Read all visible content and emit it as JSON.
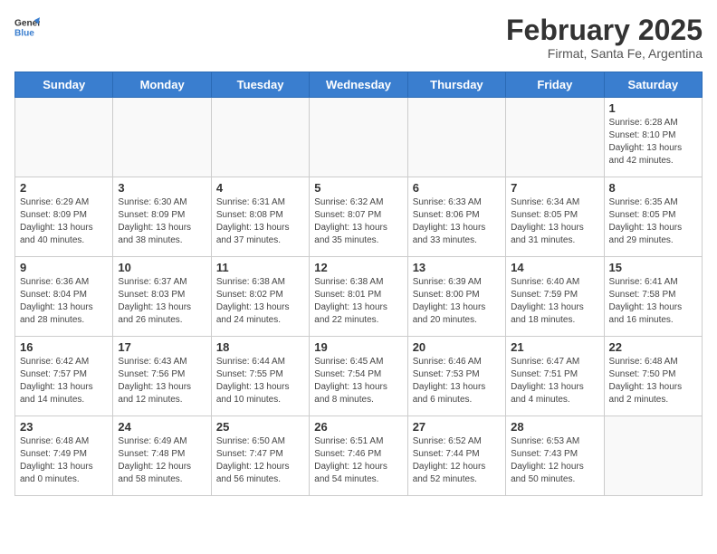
{
  "logo": {
    "general": "General",
    "blue": "Blue"
  },
  "header": {
    "title": "February 2025",
    "subtitle": "Firmat, Santa Fe, Argentina"
  },
  "days_of_week": [
    "Sunday",
    "Monday",
    "Tuesday",
    "Wednesday",
    "Thursday",
    "Friday",
    "Saturday"
  ],
  "weeks": [
    [
      {
        "day": "",
        "info": ""
      },
      {
        "day": "",
        "info": ""
      },
      {
        "day": "",
        "info": ""
      },
      {
        "day": "",
        "info": ""
      },
      {
        "day": "",
        "info": ""
      },
      {
        "day": "",
        "info": ""
      },
      {
        "day": "1",
        "info": "Sunrise: 6:28 AM\nSunset: 8:10 PM\nDaylight: 13 hours and 42 minutes."
      }
    ],
    [
      {
        "day": "2",
        "info": "Sunrise: 6:29 AM\nSunset: 8:09 PM\nDaylight: 13 hours and 40 minutes."
      },
      {
        "day": "3",
        "info": "Sunrise: 6:30 AM\nSunset: 8:09 PM\nDaylight: 13 hours and 38 minutes."
      },
      {
        "day": "4",
        "info": "Sunrise: 6:31 AM\nSunset: 8:08 PM\nDaylight: 13 hours and 37 minutes."
      },
      {
        "day": "5",
        "info": "Sunrise: 6:32 AM\nSunset: 8:07 PM\nDaylight: 13 hours and 35 minutes."
      },
      {
        "day": "6",
        "info": "Sunrise: 6:33 AM\nSunset: 8:06 PM\nDaylight: 13 hours and 33 minutes."
      },
      {
        "day": "7",
        "info": "Sunrise: 6:34 AM\nSunset: 8:05 PM\nDaylight: 13 hours and 31 minutes."
      },
      {
        "day": "8",
        "info": "Sunrise: 6:35 AM\nSunset: 8:05 PM\nDaylight: 13 hours and 29 minutes."
      }
    ],
    [
      {
        "day": "9",
        "info": "Sunrise: 6:36 AM\nSunset: 8:04 PM\nDaylight: 13 hours and 28 minutes."
      },
      {
        "day": "10",
        "info": "Sunrise: 6:37 AM\nSunset: 8:03 PM\nDaylight: 13 hours and 26 minutes."
      },
      {
        "day": "11",
        "info": "Sunrise: 6:38 AM\nSunset: 8:02 PM\nDaylight: 13 hours and 24 minutes."
      },
      {
        "day": "12",
        "info": "Sunrise: 6:38 AM\nSunset: 8:01 PM\nDaylight: 13 hours and 22 minutes."
      },
      {
        "day": "13",
        "info": "Sunrise: 6:39 AM\nSunset: 8:00 PM\nDaylight: 13 hours and 20 minutes."
      },
      {
        "day": "14",
        "info": "Sunrise: 6:40 AM\nSunset: 7:59 PM\nDaylight: 13 hours and 18 minutes."
      },
      {
        "day": "15",
        "info": "Sunrise: 6:41 AM\nSunset: 7:58 PM\nDaylight: 13 hours and 16 minutes."
      }
    ],
    [
      {
        "day": "16",
        "info": "Sunrise: 6:42 AM\nSunset: 7:57 PM\nDaylight: 13 hours and 14 minutes."
      },
      {
        "day": "17",
        "info": "Sunrise: 6:43 AM\nSunset: 7:56 PM\nDaylight: 13 hours and 12 minutes."
      },
      {
        "day": "18",
        "info": "Sunrise: 6:44 AM\nSunset: 7:55 PM\nDaylight: 13 hours and 10 minutes."
      },
      {
        "day": "19",
        "info": "Sunrise: 6:45 AM\nSunset: 7:54 PM\nDaylight: 13 hours and 8 minutes."
      },
      {
        "day": "20",
        "info": "Sunrise: 6:46 AM\nSunset: 7:53 PM\nDaylight: 13 hours and 6 minutes."
      },
      {
        "day": "21",
        "info": "Sunrise: 6:47 AM\nSunset: 7:51 PM\nDaylight: 13 hours and 4 minutes."
      },
      {
        "day": "22",
        "info": "Sunrise: 6:48 AM\nSunset: 7:50 PM\nDaylight: 13 hours and 2 minutes."
      }
    ],
    [
      {
        "day": "23",
        "info": "Sunrise: 6:48 AM\nSunset: 7:49 PM\nDaylight: 13 hours and 0 minutes."
      },
      {
        "day": "24",
        "info": "Sunrise: 6:49 AM\nSunset: 7:48 PM\nDaylight: 12 hours and 58 minutes."
      },
      {
        "day": "25",
        "info": "Sunrise: 6:50 AM\nSunset: 7:47 PM\nDaylight: 12 hours and 56 minutes."
      },
      {
        "day": "26",
        "info": "Sunrise: 6:51 AM\nSunset: 7:46 PM\nDaylight: 12 hours and 54 minutes."
      },
      {
        "day": "27",
        "info": "Sunrise: 6:52 AM\nSunset: 7:44 PM\nDaylight: 12 hours and 52 minutes."
      },
      {
        "day": "28",
        "info": "Sunrise: 6:53 AM\nSunset: 7:43 PM\nDaylight: 12 hours and 50 minutes."
      },
      {
        "day": "",
        "info": ""
      }
    ]
  ]
}
